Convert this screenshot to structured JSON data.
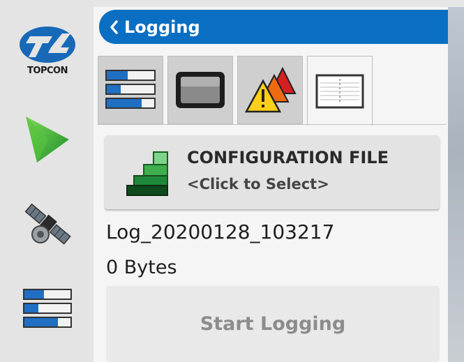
{
  "header": {
    "title": "Logging",
    "back_icon": "chevron-left-icon"
  },
  "rail": {
    "logo_text": "TOPCON",
    "items": [
      {
        "icon": "topcon-logo-icon"
      },
      {
        "icon": "play-triangle-icon"
      },
      {
        "icon": "satellite-icon"
      },
      {
        "icon": "bar-list-icon"
      }
    ]
  },
  "tabs": [
    {
      "icon": "bar-list-icon",
      "active": false
    },
    {
      "icon": "display-monitor-icon",
      "active": false
    },
    {
      "icon": "warning-alerts-icon",
      "active": false
    },
    {
      "icon": "log-file-icon",
      "active": true
    }
  ],
  "config": {
    "title": "CONFIGURATION FILE",
    "value": "<Click to Select>",
    "icon": "stairs-icon"
  },
  "log": {
    "name": "Log_20200128_103217",
    "size": "0 Bytes"
  },
  "actions": {
    "start_label": "Start Logging"
  },
  "colors": {
    "accent": "#0a6fc2",
    "arrow_green": "#2fae3a"
  }
}
